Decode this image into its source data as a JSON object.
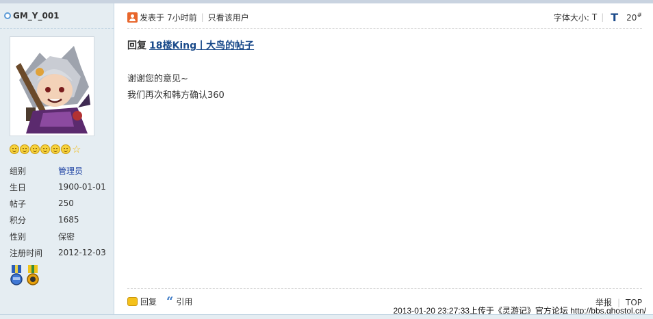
{
  "author": {
    "name": "GM_Y_001"
  },
  "profile": {
    "rows": [
      {
        "label": "组别",
        "value": "管理员"
      },
      {
        "label": "生日",
        "value": "1900-01-01"
      },
      {
        "label": "帖子",
        "value": "250"
      },
      {
        "label": "积分",
        "value": "1685"
      },
      {
        "label": "性别",
        "value": "保密"
      },
      {
        "label": "注册时间",
        "value": "2012-12-03"
      }
    ]
  },
  "post": {
    "posted_prefix": "发表于",
    "posted_time": "7小时前",
    "view_author_only": "只看该用户",
    "font_size_label": "字体大小:",
    "font_small": "T",
    "font_big": "T",
    "floor_number": "20",
    "floor_suffix": "#",
    "reply_prefix": "回复",
    "reply_link": "18楼King丨大鸟的帖子",
    "body_lines": [
      "谢谢您的意见~",
      "我们再次和韩方确认360"
    ]
  },
  "footer": {
    "reply_label": "回复",
    "quote_label": "引用",
    "report_label": "举报",
    "top_label": "TOP"
  },
  "watermark": {
    "text": "2013-01-20 23:27:33上传于《灵游记》官方论坛  http://bbs.ghostol.cn/"
  },
  "colors": {
    "accent_link": "#1a4a8a",
    "sidebar_bg": "#e5edf2",
    "star": "#f2b705"
  }
}
